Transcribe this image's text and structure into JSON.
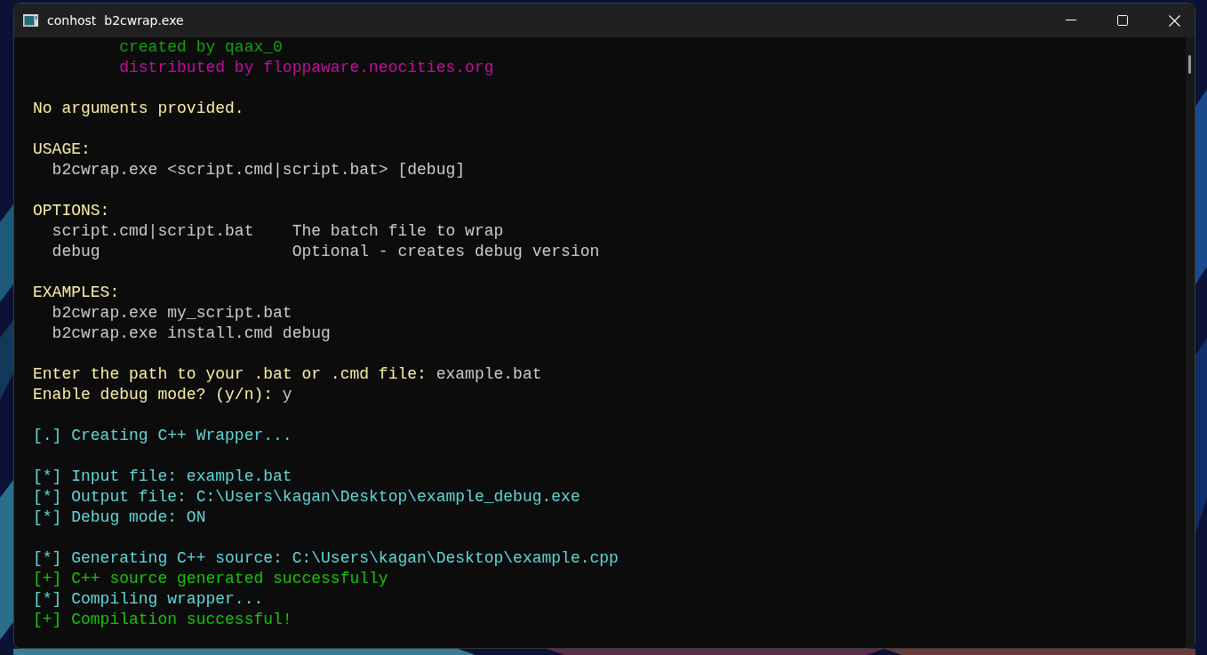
{
  "window": {
    "title": "conhost  b2cwrap.exe"
  },
  "console": {
    "blocks": [
      {
        "lines": [
          {
            "segments": [
              {
                "text": "         created by qaax_0",
                "color": "#13a10e"
              }
            ]
          },
          {
            "segments": [
              {
                "text": "         distributed by floppaware.neocities.org",
                "color": "#c50f9f"
              }
            ]
          }
        ]
      },
      {
        "lines": [
          {
            "segments": [
              {
                "text": "No arguments provided.",
                "color": "#f9f1a5"
              }
            ]
          }
        ]
      },
      {
        "lines": [
          {
            "segments": [
              {
                "text": "USAGE:",
                "color": "#f9f1a5"
              }
            ]
          },
          {
            "segments": [
              {
                "text": "  b2cwrap.exe <script.cmd|script.bat> [debug]",
                "color": "#cccccc"
              }
            ]
          }
        ]
      },
      {
        "lines": [
          {
            "segments": [
              {
                "text": "OPTIONS:",
                "color": "#f9f1a5"
              }
            ]
          },
          {
            "segments": [
              {
                "text": "  script.cmd|script.bat    The batch file to wrap",
                "color": "#cccccc"
              }
            ]
          },
          {
            "segments": [
              {
                "text": "  debug                    Optional - creates debug version",
                "color": "#cccccc"
              }
            ]
          }
        ]
      },
      {
        "lines": [
          {
            "segments": [
              {
                "text": "EXAMPLES:",
                "color": "#f9f1a5"
              }
            ]
          },
          {
            "segments": [
              {
                "text": "  b2cwrap.exe my_script.bat",
                "color": "#cccccc"
              }
            ]
          },
          {
            "segments": [
              {
                "text": "  b2cwrap.exe install.cmd debug",
                "color": "#cccccc"
              }
            ]
          }
        ]
      },
      {
        "lines": [
          {
            "segments": [
              {
                "text": "Enter the path to your .bat or .cmd file: ",
                "color": "#f9f1a5"
              },
              {
                "text": "example.bat",
                "color": "#cccccc"
              }
            ]
          },
          {
            "segments": [
              {
                "text": "Enable debug mode? (y/n): ",
                "color": "#f9f1a5"
              },
              {
                "text": "y",
                "color": "#cccccc"
              }
            ]
          }
        ]
      },
      {
        "lines": [
          {
            "segments": [
              {
                "text": "[.] Creating C++ Wrapper...",
                "color": "#61d6d6"
              }
            ]
          }
        ]
      },
      {
        "lines": [
          {
            "segments": [
              {
                "text": "[*] Input file: example.bat",
                "color": "#61d6d6"
              }
            ]
          },
          {
            "segments": [
              {
                "text": "[*] Output file: C:\\Users\\kagan\\Desktop\\example_debug.exe",
                "color": "#61d6d6"
              }
            ]
          },
          {
            "segments": [
              {
                "text": "[*] Debug mode: ON",
                "color": "#61d6d6"
              }
            ]
          }
        ]
      },
      {
        "lines": [
          {
            "segments": [
              {
                "text": "[*] Generating C++ source: C:\\Users\\kagan\\Desktop\\example.cpp",
                "color": "#61d6d6"
              }
            ]
          },
          {
            "segments": [
              {
                "text": "[+] C++ source generated successfully",
                "color": "#16c60c"
              }
            ]
          },
          {
            "segments": [
              {
                "text": "[*] Compiling wrapper...",
                "color": "#61d6d6"
              }
            ]
          },
          {
            "segments": [
              {
                "text": "[+] Compilation successful!",
                "color": "#16c60c"
              }
            ]
          }
        ]
      }
    ]
  }
}
